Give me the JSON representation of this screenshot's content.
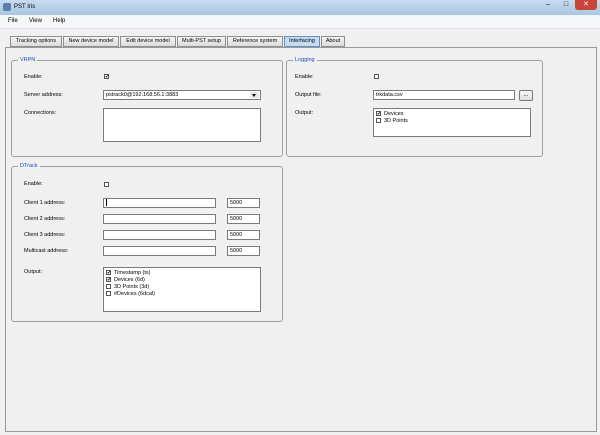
{
  "window": {
    "title": "PST Iris",
    "min": "–",
    "max": "□",
    "close": "✕"
  },
  "menu": [
    "File",
    "View",
    "Help"
  ],
  "tabs": [
    "Tracking options",
    "New device model",
    "Edit device model",
    "Multi-PST setup",
    "Reference system",
    "Interfacing",
    "About"
  ],
  "active_tab": "Interfacing",
  "vrpn": {
    "legend": "VRPN",
    "enable_label": "Enable:",
    "enable_checked": true,
    "server_label": "Server address:",
    "server_value": "pstrack0@192.168.56.1:3883",
    "connections_label": "Connections:"
  },
  "logging": {
    "legend": "Logging",
    "enable_label": "Enable:",
    "enable_checked": false,
    "output_file_label": "Output file:",
    "output_file_value": "trkdata.csv",
    "browse_label": "...",
    "output_label": "Output:",
    "output_items": [
      {
        "label": "Devices",
        "checked": true
      },
      {
        "label": "3D Points",
        "checked": false
      }
    ]
  },
  "dtrack": {
    "legend": "DTrack",
    "enable_label": "Enable:",
    "enable_checked": false,
    "rows": [
      {
        "label": "Client 1 address:",
        "value": "",
        "port": "5000"
      },
      {
        "label": "Client 2 address:",
        "value": "",
        "port": "5000"
      },
      {
        "label": "Client 3 address:",
        "value": "",
        "port": "5000"
      },
      {
        "label": "Multicast address:",
        "value": "",
        "port": "5000"
      }
    ],
    "output_label": "Output:",
    "output_items": [
      {
        "label": "Timestamp  (ts)",
        "checked": true
      },
      {
        "label": "Devices  (6d)",
        "checked": true
      },
      {
        "label": "3D Points (3d)",
        "checked": false
      },
      {
        "label": "#Devices  (6dcal)",
        "checked": false
      }
    ]
  },
  "checked_mark": "✔"
}
